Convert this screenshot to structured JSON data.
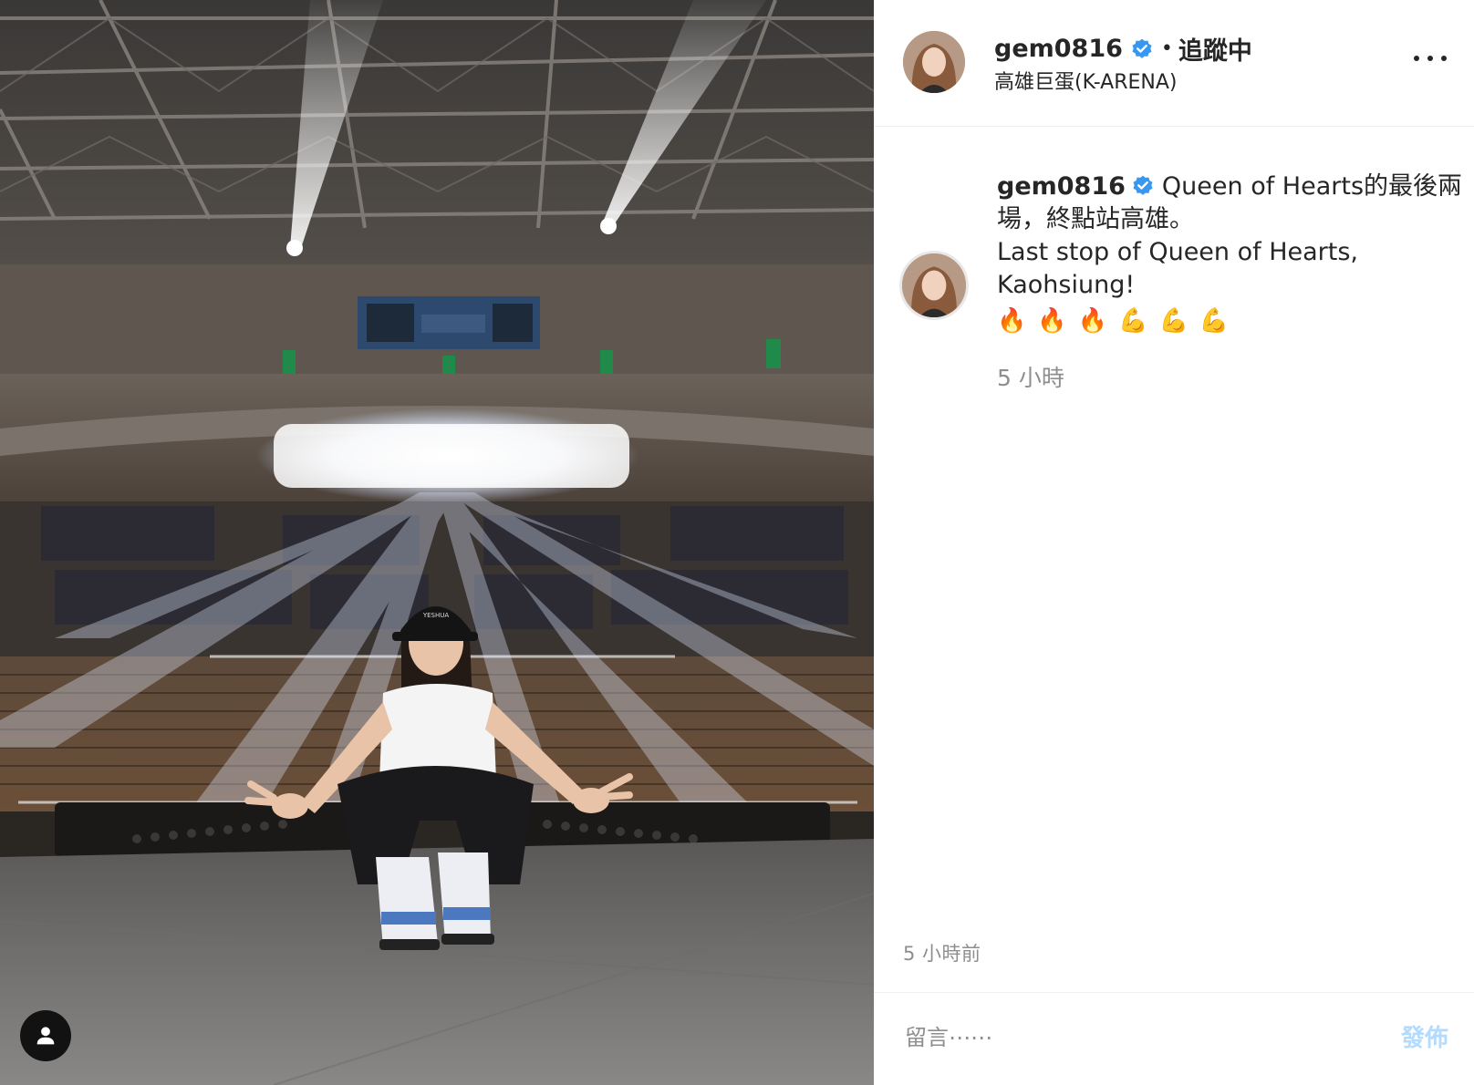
{
  "header": {
    "username": "gem0816",
    "separator": "•",
    "follow_status": "追蹤中",
    "location": "高雄巨蛋(K-ARENA)"
  },
  "caption": {
    "username": "gem0816",
    "line1": "Queen of Hearts的最後兩",
    "line2": "場，終點站高雄。",
    "line3": "Last stop of Queen of Hearts,",
    "line4": "Kaohsiung!",
    "emojis": [
      "🔥",
      "🔥",
      "🔥",
      "💪",
      "💪",
      "💪"
    ],
    "time": "5 小時"
  },
  "footer": {
    "time_ago": "5 小時前",
    "comment_placeholder": "留言⋯⋯",
    "post_label": "發佈"
  },
  "photo": {
    "cap_text": "YESHUA"
  },
  "colors": {
    "verified_blue": "#3897f0",
    "post_button_disabled": "#b3dbff",
    "meta_gray": "#8e8e8e"
  },
  "icons": {
    "verified": "verified-badge-icon",
    "more": "more-options-icon",
    "tag": "user-tag-icon"
  }
}
